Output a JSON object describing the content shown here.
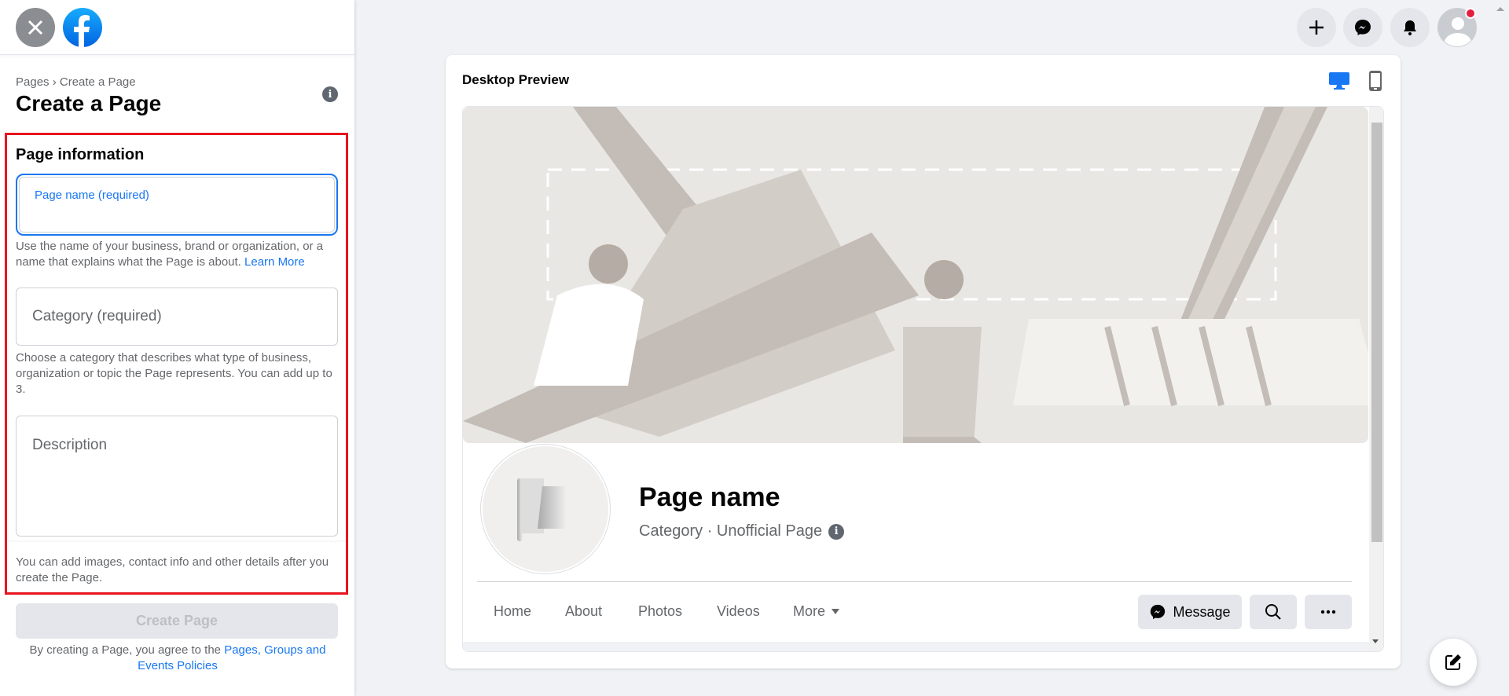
{
  "sidebar": {
    "breadcrumb": "Pages › Create a Page",
    "title": "Create a Page",
    "section_title": "Page information",
    "page_name_label": "Page name (required)",
    "page_name_value": "",
    "page_name_help": "Use the name of your business, brand or organization, or a name that explains what the Page is about.",
    "learn_more": "Learn More",
    "category_placeholder": "Category (required)",
    "category_help": "Choose a category that describes what type of business, organization or topic the Page represents. You can add up to 3.",
    "description_placeholder": "Description",
    "footer_note": "You can add images, contact info and other details after you create the Page.",
    "create_button": "Create Page",
    "terms_prefix": "By creating a Page, you agree to the",
    "terms_link": "Pages, Groups and Events Policies"
  },
  "preview": {
    "title": "Desktop Preview",
    "page_name": "Page name",
    "category_line": "Category · Unofficial Page",
    "tabs": [
      "Home",
      "About",
      "Photos",
      "Videos",
      "More"
    ],
    "message_button": "Message"
  },
  "colors": {
    "accent": "#1877f2",
    "highlight": "#e8141e",
    "notification": "#e41e3f"
  }
}
